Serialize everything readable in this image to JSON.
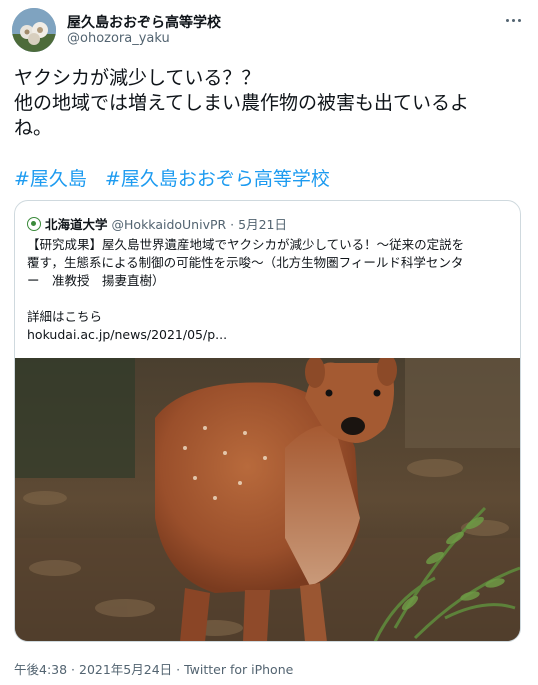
{
  "author": {
    "name": "屋久島おおぞら高等学校",
    "handle": "@ohozora_yaku",
    "avatar_icon": "school-avatar-icon"
  },
  "tweet": {
    "lines": [
      "ヤクシカが減少している？？",
      "他の地域では増えてしまい農作物の被害も出ているよ",
      "ね。"
    ],
    "hashtags": [
      "#屋久島",
      "#屋久島おおぞら高等学校"
    ]
  },
  "quote": {
    "name": "北海道大学",
    "handle": "@HokkaidoUnivPR",
    "date": "5月21日",
    "lines": [
      "【研究成果】屋久島世界遺産地域でヤクシカが減少している！～従来の定説を",
      "覆す，生態系による制御の可能性を示唆～（北方生物圏フィールド科学センタ",
      "ー　准教授　揚妻直樹）"
    ],
    "details_label": "詳細はこちら",
    "link": "hokudai.ac.jp/news/2021/05/p..."
  },
  "meta": {
    "time": "午後4:38",
    "date": "2021年5月24日",
    "source": "Twitter for iPhone"
  },
  "colors": {
    "link": "#1d9bf0",
    "secondary_text": "#536471",
    "border": "#cfd9de"
  }
}
